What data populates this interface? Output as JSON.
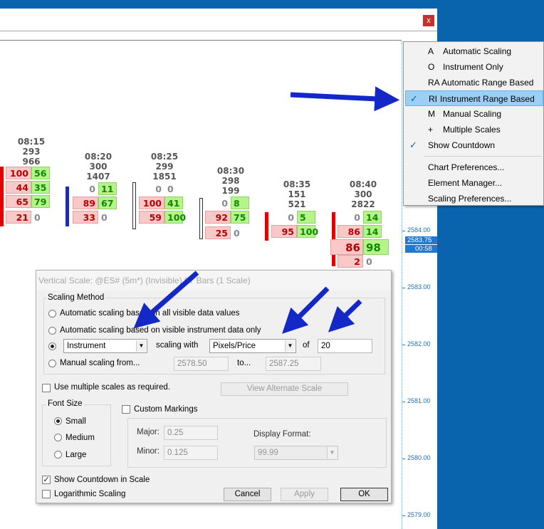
{
  "window": {
    "close_glyph": "x"
  },
  "chart": {
    "bars": [
      {
        "time": "08:15",
        "vol1": "293",
        "vol2": "966",
        "rows": [
          {
            "bid": "100",
            "ask": "56"
          },
          {
            "bid": "44",
            "ask": "35"
          },
          {
            "bid": "65",
            "ask": "79"
          },
          {
            "bid": "21",
            "ask": "0"
          }
        ]
      },
      {
        "time": "08:20",
        "vol1": "300",
        "vol2": "1407",
        "rows": [
          {
            "bid": "0",
            "ask": "11"
          },
          {
            "bid": "89",
            "ask": "67"
          },
          {
            "bid": "33",
            "ask": "0"
          }
        ]
      },
      {
        "time": "08:25",
        "vol1": "299",
        "vol2": "1851",
        "rows": [
          {
            "bid": "0",
            "ask": "0"
          },
          {
            "bid": "100",
            "ask": "41"
          },
          {
            "bid": "59",
            "ask": "100"
          }
        ]
      },
      {
        "time": "08:30",
        "vol1": "298",
        "vol2": "199",
        "rows": [
          {
            "bid": "0",
            "ask": "8"
          },
          {
            "bid": "92",
            "ask": "75"
          },
          {
            "bid": "25",
            "ask": "0"
          }
        ]
      },
      {
        "time": "08:35",
        "vol1": "151",
        "vol2": "521",
        "rows": [
          {
            "bid": "0",
            "ask": "5"
          },
          {
            "bid": "95",
            "ask": "100"
          }
        ]
      },
      {
        "time": "08:40",
        "vol1": "300",
        "vol2": "2822",
        "rows": [
          {
            "bid": "0",
            "ask": "14"
          },
          {
            "bid": "86",
            "ask": "14"
          },
          {
            "bid": "86",
            "ask": "98"
          },
          {
            "bid": "2",
            "ask": "0"
          }
        ]
      }
    ]
  },
  "price_axis": {
    "labels": [
      "2584.00",
      "2583.00",
      "2582.00",
      "2581.00",
      "2580.00",
      "2579.00"
    ],
    "current_price": "2583.75",
    "countdown": "00:58"
  },
  "context_menu": {
    "items": [
      {
        "key": "A",
        "label": "Automatic Scaling",
        "checked": false
      },
      {
        "key": "O",
        "label": "Instrument Only",
        "checked": false
      },
      {
        "key": "RA",
        "label": "Automatic Range Based",
        "checked": false
      },
      {
        "key": "RI",
        "label": "Instrument Range Based",
        "checked": true
      },
      {
        "key": "M",
        "label": "Manual Scaling",
        "checked": false
      },
      {
        "key": "+",
        "label": "Multiple Scales",
        "checked": false
      },
      {
        "key": "",
        "label": "Show Countdown",
        "checked": true
      }
    ],
    "items2": [
      "Chart Preferences...",
      "Element Manager...",
      "Scaling Preferences..."
    ],
    "check_glyph": "✓"
  },
  "dialog": {
    "title": "Vertical Scale: @ES# (5m*) (Invisible) 97 Bars (1 Scale)",
    "scaling_method": {
      "group_title": "Scaling Method",
      "opt_all": "Automatic scaling based on all visible data values",
      "opt_instrument_visible": "Automatic scaling based on visible instrument data only",
      "instrument_combo": "Instrument",
      "scaling_with": "scaling with",
      "scaling_combo": "Pixels/Price",
      "of": "of",
      "of_value": "20",
      "opt_manual": "Manual scaling from...",
      "from_value": "2578.50",
      "to": "to...",
      "to_value": "2587.25"
    },
    "multiple_scales": "Use multiple scales as required.",
    "view_alt_scale": "View Alternate Scale",
    "font_size": {
      "group_title": "Font Size",
      "small": "Small",
      "medium": "Medium",
      "large": "Large"
    },
    "custom_markings": {
      "label": "Custom Markings",
      "major_label": "Major:",
      "major_value": "0.25",
      "minor_label": "Minor:",
      "minor_value": "0.125",
      "display_format_label": "Display Format:",
      "display_format_value": "99.99"
    },
    "show_countdown": "Show Countdown in Scale",
    "log_scaling": "Logarithmic Scaling",
    "cancel": "Cancel",
    "apply": "Apply",
    "ok": "OK",
    "check_glyph": "✓",
    "arrow_glyph": "▼"
  },
  "colors": {
    "desktop": "#0a64ad",
    "arrow": "#1428c8",
    "bid_cell": "#f9c8c8",
    "ask_cell": "#b6f38a",
    "menu_highlight": "#9ccff5"
  }
}
